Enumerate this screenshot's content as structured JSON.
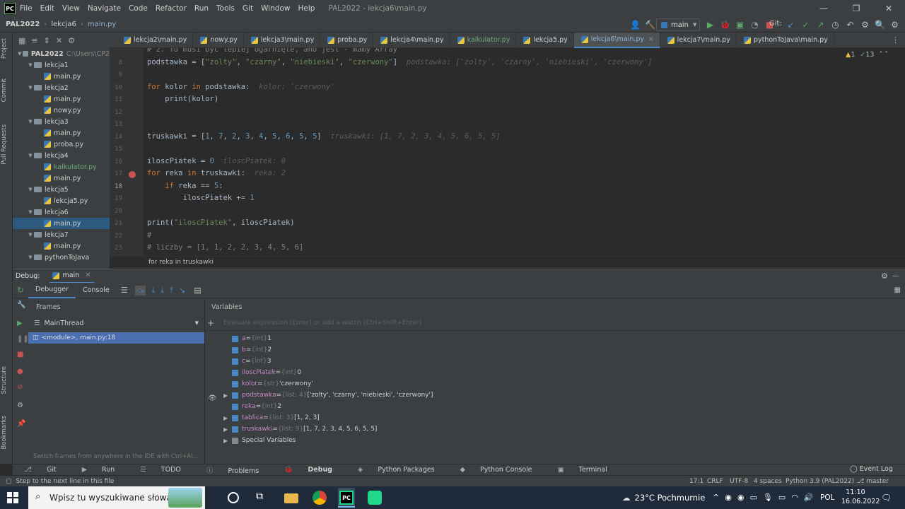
{
  "titlebar": {
    "logo": "PC",
    "menu": [
      "File",
      "Edit",
      "View",
      "Navigate",
      "Code",
      "Refactor",
      "Run",
      "Tools",
      "Git",
      "Window",
      "Help"
    ],
    "title": "PAL2022 - lekcja6\\main.py",
    "min": "—",
    "max": "❐",
    "close": "✕"
  },
  "navbar": {
    "project": "PAL2022",
    "folder": "lekcja6",
    "file": "main.py",
    "run_config": "main",
    "git_label": "Git:"
  },
  "project_panel": {
    "label": "Project",
    "root": "PAL2022",
    "root_path": "C:\\Users\\CP2",
    "items": [
      {
        "type": "folder",
        "label": "lekcja1",
        "indent": 1
      },
      {
        "type": "file",
        "label": "main.py",
        "indent": 2
      },
      {
        "type": "folder",
        "label": "lekcja2",
        "indent": 1
      },
      {
        "type": "file",
        "label": "main.py",
        "indent": 2
      },
      {
        "type": "file",
        "label": "nowy.py",
        "indent": 2
      },
      {
        "type": "folder",
        "label": "lekcja3",
        "indent": 1
      },
      {
        "type": "file",
        "label": "main.py",
        "indent": 2
      },
      {
        "type": "file",
        "label": "proba.py",
        "indent": 2
      },
      {
        "type": "folder",
        "label": "lekcja4",
        "indent": 1
      },
      {
        "type": "file",
        "label": "kalkulator.py",
        "indent": 2,
        "modified": true
      },
      {
        "type": "file",
        "label": "main.py",
        "indent": 2
      },
      {
        "type": "folder",
        "label": "lekcja5",
        "indent": 1
      },
      {
        "type": "file",
        "label": "lekcja5.py",
        "indent": 2
      },
      {
        "type": "folder",
        "label": "lekcja6",
        "indent": 1
      },
      {
        "type": "file",
        "label": "main.py",
        "indent": 2,
        "selected": true
      },
      {
        "type": "folder",
        "label": "lekcja7",
        "indent": 1
      },
      {
        "type": "file",
        "label": "main.py",
        "indent": 2
      },
      {
        "type": "folder",
        "label": "pythonToJava",
        "indent": 1
      }
    ]
  },
  "side_labels": [
    "Project",
    "Commit",
    "Pull Requests",
    "Structure",
    "Bookmarks"
  ],
  "tabs": [
    {
      "label": "lekcja2\\main.py"
    },
    {
      "label": "nowy.py"
    },
    {
      "label": "lekcja3\\main.py"
    },
    {
      "label": "proba.py"
    },
    {
      "label": "lekcja4\\main.py"
    },
    {
      "label": "kalkulator.py",
      "modified": true
    },
    {
      "label": "lekcja5.py"
    },
    {
      "label": "lekcja6\\main.py",
      "active": true
    },
    {
      "label": "lekcja7\\main.py"
    },
    {
      "label": "pythonToJava\\main.py"
    }
  ],
  "inspections": {
    "warnings": "1",
    "weak": "13"
  },
  "editor": {
    "lines": [
      {
        "n": "",
        "code": "# 2. To musi być lepiej ogarnięte, ano jest - mamy Array"
      },
      {
        "n": "8",
        "code": "podstawka = [\"zolty\", \"czarny\", \"niebieski\", \"czerwony\"]",
        "hint": "podstawka: ['zolty', 'czarny', 'niebieski', 'czerwony']"
      },
      {
        "n": "9",
        "code": ""
      },
      {
        "n": "10",
        "code": "for kolor in podstawka:",
        "hint": "kolor: 'czerwony'"
      },
      {
        "n": "11",
        "code": "    print(kolor)"
      },
      {
        "n": "12",
        "code": ""
      },
      {
        "n": "13",
        "code": ""
      },
      {
        "n": "14",
        "code": "truskawki = [1, 7, 2, 3, 4, 5, 6, 5, 5]",
        "hint": "truskawki: [1, 7, 2, 3, 4, 5, 6, 5, 5]"
      },
      {
        "n": "15",
        "code": ""
      },
      {
        "n": "16",
        "code": "iloscPiatek = 0",
        "hint": "iloscPiatek: 0"
      },
      {
        "n": "17",
        "code": "for reka in truskawki:",
        "hint": "reka: 2"
      },
      {
        "n": "18",
        "code": "    if reka == 5:"
      },
      {
        "n": "19",
        "code": "        iloscPiatek += 1"
      },
      {
        "n": "20",
        "code": ""
      },
      {
        "n": "21",
        "code": "print(\"iloscPiatek\", iloscPiatek)"
      },
      {
        "n": "22",
        "code": "#"
      },
      {
        "n": "23",
        "code": "# liczby = [1, 1, 2, 2, 3, 4, 5, 6]"
      }
    ],
    "breadcrumb": "for reka in truskawki"
  },
  "debug": {
    "label": "Debug:",
    "config": "main",
    "tabs": [
      "Debugger",
      "Console"
    ],
    "frames_header": "Frames",
    "variables_header": "Variables",
    "thread": "MainThread",
    "frame": "<module>, main.py:18",
    "hint": "Switch frames from anywhere in the IDE with Ctrl+Al...",
    "eval_placeholder": "Evaluate expression (Enter) or add a watch (Ctrl+Shift+Enter)",
    "variables": [
      {
        "name": "a",
        "type": "{int}",
        "value": "1"
      },
      {
        "name": "b",
        "type": "{int}",
        "value": "2"
      },
      {
        "name": "c",
        "type": "{int}",
        "value": "3"
      },
      {
        "name": "iloscPiatek",
        "type": "{int}",
        "value": "0"
      },
      {
        "name": "kolor",
        "type": "{str}",
        "value": "'czerwony'"
      },
      {
        "name": "podstawka",
        "type": "{list: 4}",
        "value": "['zolty', 'czarny', 'niebieski', 'czerwony']",
        "expandable": true
      },
      {
        "name": "reka",
        "type": "{int}",
        "value": "2"
      },
      {
        "name": "tablica",
        "type": "{list: 3}",
        "value": "[1, 2, 3]",
        "expandable": true
      },
      {
        "name": "truskawki",
        "type": "{list: 9}",
        "value": "[1, 7, 2, 3, 4, 5, 6, 5, 5]",
        "expandable": true
      },
      {
        "name": "Special Variables",
        "type": "",
        "value": "",
        "expandable": true,
        "special": true
      }
    ]
  },
  "bottom_tools": [
    "Git",
    "Run",
    "TODO",
    "Problems",
    "Debug",
    "Python Packages",
    "Python Console",
    "Terminal"
  ],
  "event_log": "Event Log",
  "status": {
    "message": "Step to the next line in this file",
    "position": "17:1",
    "line_sep": "CRLF",
    "encoding": "UTF-8",
    "indent": "4 spaces",
    "interpreter": "Python 3.9 (PAL2022)",
    "branch": "master"
  },
  "taskbar": {
    "search_placeholder": "Wpisz tu wyszukiwane słowa",
    "weather": "23°C  Pochmurnie",
    "lang": "POL",
    "time": "11:10",
    "date": "16.06.2022"
  }
}
